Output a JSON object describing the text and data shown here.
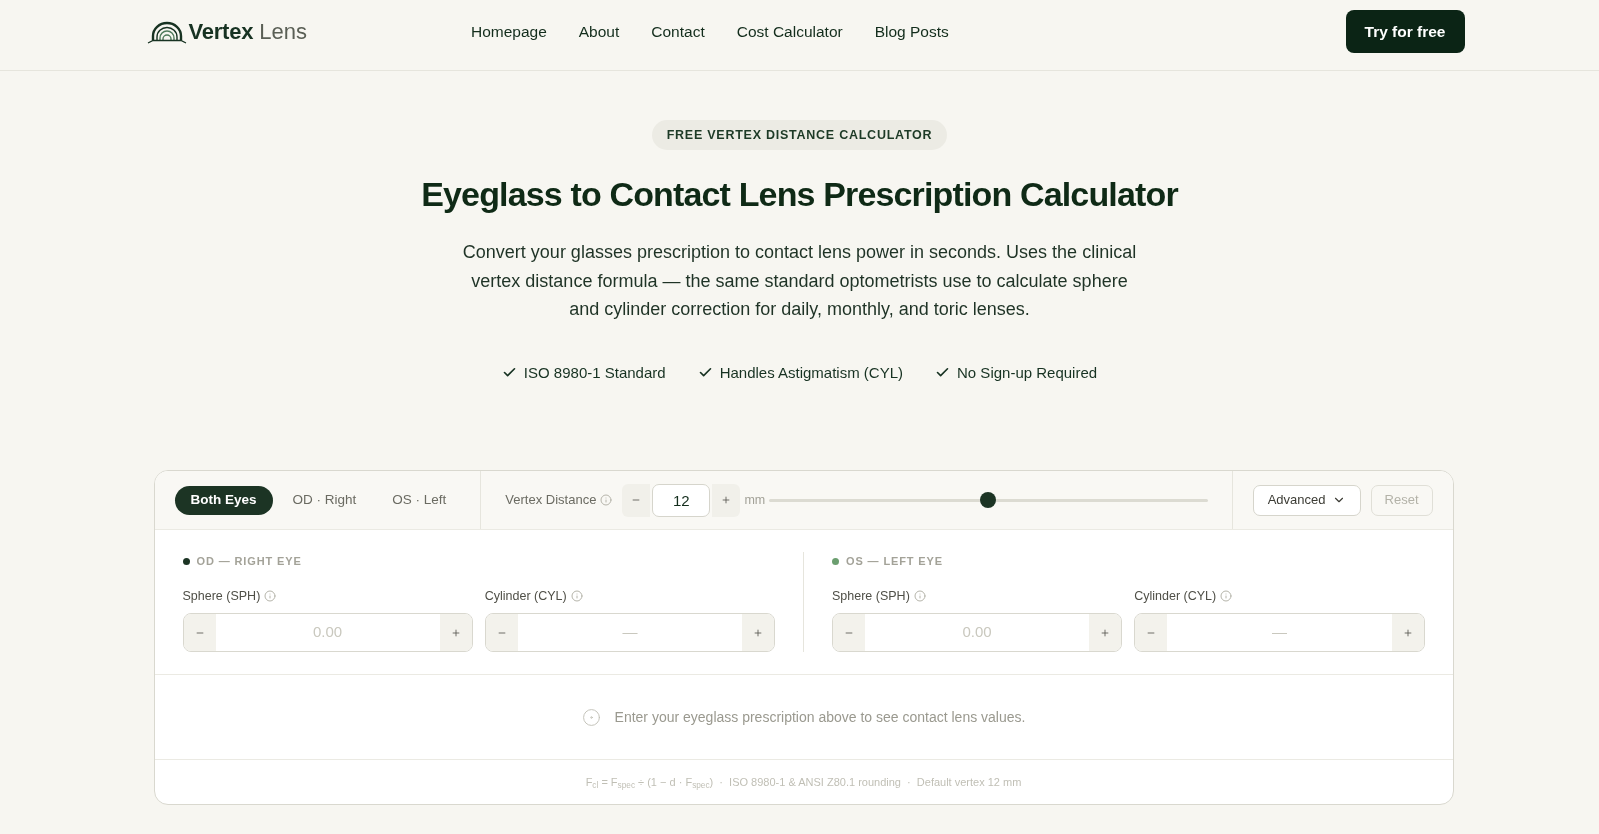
{
  "header": {
    "logo": {
      "bold": "Vertex",
      "light": "Lens"
    },
    "nav": [
      "Homepage",
      "About",
      "Contact",
      "Cost Calculator",
      "Blog Posts"
    ],
    "cta": "Try for free"
  },
  "hero": {
    "badge": "FREE VERTEX DISTANCE CALCULATOR",
    "title": "Eyeglass to Contact Lens Prescription Calculator",
    "description": "Convert your glasses prescription to contact lens power in seconds. Uses the clinical vertex distance formula — the same standard optometrists use to calculate sphere and cylinder correction for daily, monthly, and toric lenses.",
    "features": [
      "ISO 8980-1 Standard",
      "Handles Astigmatism (CYL)",
      "No Sign-up Required"
    ]
  },
  "calculator": {
    "tabs": [
      {
        "label": "Both Eyes",
        "selected": true
      },
      {
        "label": "OD · Right",
        "selected": false
      },
      {
        "label": "OS · Left",
        "selected": false
      }
    ],
    "vertex": {
      "label": "Vertex Distance",
      "value": "12",
      "unit": "mm",
      "level": 0.5
    },
    "advanced": {
      "label": "Advanced"
    },
    "reset": {
      "label": "Reset",
      "disabled": true
    },
    "eyes": [
      {
        "label": "OD — RIGHT EYE",
        "color": "#1c3424",
        "fields": [
          {
            "label": "Sphere (SPH)",
            "placeholder": "0.00"
          },
          {
            "label": "Cylinder (CYL)",
            "placeholder": "—"
          }
        ]
      },
      {
        "label": "OS — LEFT EYE",
        "color": "#6b9e6f",
        "fields": [
          {
            "label": "Sphere (SPH)",
            "placeholder": "0.00"
          },
          {
            "label": "Cylinder (CYL)",
            "placeholder": "—"
          }
        ]
      }
    ],
    "empty_message": "Enter your eyeglass prescription above to see contact lens values.",
    "footnote": "F$_{cl}$ = F$_{spec}$ ÷ (1 − d · F$_{spec}$)  ·  ISO 8980-1 & ANSI Z80.1 rounding  ·  Default vertex 12 mm"
  }
}
